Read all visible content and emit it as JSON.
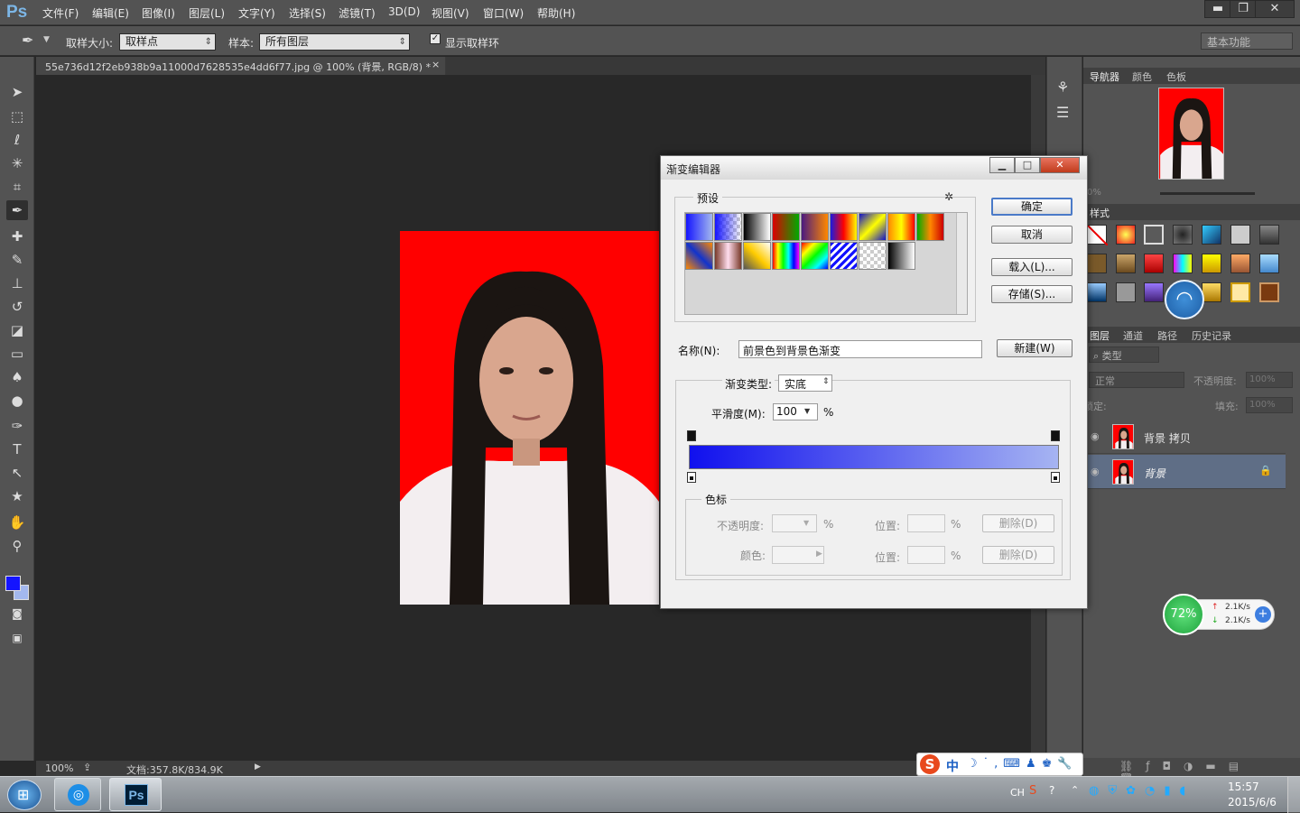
{
  "app": {
    "logo": "Ps"
  },
  "menubar": {
    "items": [
      "文件(F)",
      "编辑(E)",
      "图像(I)",
      "图层(L)",
      "文字(Y)",
      "选择(S)",
      "滤镜(T)",
      "3D(D)",
      "视图(V)",
      "窗口(W)",
      "帮助(H)"
    ]
  },
  "window_controls": {
    "minimize": "▬",
    "restore": "❐",
    "close": "✕"
  },
  "options": {
    "sample_size_label": "取样大小:",
    "sample_size_value": "取样点",
    "sample_label": "样本:",
    "sample_value": "所有图层",
    "show_ring_label": "显示取样环",
    "show_ring_checked": "✓",
    "workspace": "基本功能"
  },
  "document": {
    "tab_title": "55e736d12f2eb938b9a11000d7628535e4dd6f77.jpg @ 100% (背景, RGB/8) *",
    "tab_close": "×"
  },
  "colors": {
    "foreground": "#1414ff",
    "background": "#a3b8ee",
    "photo_bg": "#ff0000"
  },
  "status": {
    "zoom": "100%",
    "doc_size": "文档:357.8K/834.9K"
  },
  "panels": {
    "nav_tabs": [
      "导航器",
      "颜色",
      "色板"
    ],
    "nav_zoom": "0%",
    "styles_tab": "样式",
    "layer_tabs": [
      "图层",
      "通道",
      "路径",
      "历史记录"
    ],
    "filter_kind": "类型",
    "blend_mode": "正常",
    "opacity_label": "不透明度:",
    "opacity_value": "100%",
    "lock_label": "锁定:",
    "fill_label": "填充:",
    "fill_value": "100%",
    "layers": [
      {
        "name": "背景 拷贝",
        "selected": false
      },
      {
        "name": "背景",
        "selected": true
      }
    ]
  },
  "dialog": {
    "title": "渐变编辑器",
    "presets_legend": "预设",
    "buttons": {
      "ok": "确定",
      "cancel": "取消",
      "load": "载入(L)...",
      "save": "存储(S)...",
      "new": "新建(W)"
    },
    "name_label": "名称(N):",
    "name_value": "前景色到背景色渐变",
    "type_label": "渐变类型:",
    "type_value": "实底",
    "smooth_label": "平滑度(M):",
    "smooth_value": "100",
    "percent": "%",
    "stops_legend": "色标",
    "stop_opacity_label": "不透明度:",
    "stop_color_label": "颜色:",
    "position_label": "位置:",
    "delete_label": "删除(D)",
    "gradient_start": "#1010ee",
    "gradient_end": "#a6b4f2"
  },
  "widget": {
    "percent": "72%",
    "up": "2.1K/s",
    "down": "2.1K/s"
  },
  "ime": {
    "mode": "中"
  },
  "taskbar": {
    "lang": "CH",
    "time": "15:57",
    "date": "2015/6/6",
    "ps_label": "Ps"
  }
}
